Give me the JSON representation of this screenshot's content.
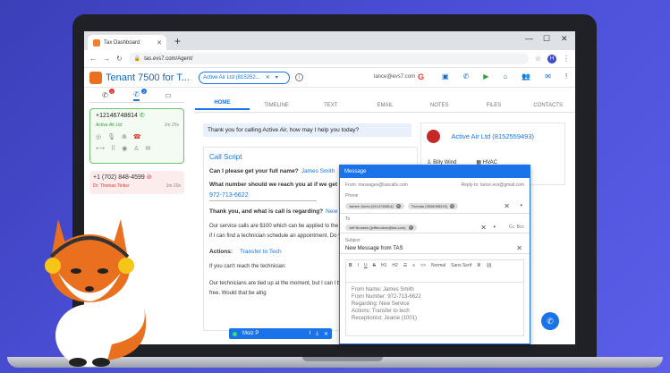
{
  "browser": {
    "tab_title": "Tax Dashboard",
    "url": "tas.evs7.com/Agent/",
    "profile_initial": "H"
  },
  "header": {
    "title": "Tenant 7500 for T...",
    "client_select": "Active Air Ltd (815252...",
    "user_email": "lance@evs7.com"
  },
  "left_panel": {
    "tab_badges": [
      "1",
      "2"
    ],
    "active_call": {
      "number": "+12146748814",
      "name": "Active Air Ltd",
      "duration": "1m 25s"
    },
    "other_call": {
      "number": "+1 (702) 848-4599",
      "name": "Dr. Thomas Tinker",
      "duration": "1m 20s"
    }
  },
  "main": {
    "tabs": [
      "HOME",
      "TIMELINE",
      "TEXT",
      "EMAIL",
      "NOTES",
      "FILES",
      "CONTACTS"
    ],
    "greeting": "Thank you for calling Active Air, how may I help you today?",
    "script": {
      "title": "Call Script",
      "q1": "Can I please get your full name?",
      "a1": "James Smith",
      "q2": "What number should we reach you at if we get",
      "a2": "972-713-6622",
      "q3": "Thank you, and what is call is regarding?",
      "a3": "New",
      "paragraph1": "Our service calls are $100 which can be applied to the for your business. Let me see if I can find a technician schedule an appointment. Do you mind holding?",
      "actions_label": "Actions:",
      "actions_value": "Transfer to Tech",
      "line2": "If you can't reach the technician:",
      "paragraph2": "Our technicians are tied up at the moment, but I can l back just as soon as one gets free. Would that be alrig"
    }
  },
  "client_card": {
    "name": "Active Air Ltd (8152559493)",
    "contact": "Billy Wind",
    "category": "HVAC"
  },
  "message_modal": {
    "title": "Message",
    "from": "From: messages@tascalls.com",
    "reply_to": "Reply-to: lance.evs@gmail.com",
    "phone_label": "Phone",
    "phone_chips": [
      "James Jones (2414748814)",
      "Thomas (3538288415)"
    ],
    "to_label": "To",
    "to_chips": [
      "Jeff Brookes (jeffbrookes@tas.com)"
    ],
    "cc": "Cc",
    "bcc": "Bcc",
    "subject_label": "Subject",
    "subject": "New Message from TAS",
    "toolbar": [
      "B",
      "I",
      "U",
      "S",
      "H1",
      "H2",
      "Normal",
      "Sans Serif"
    ],
    "body_lines": [
      "From Name: James Smith",
      "From Number: 972-713-6622",
      "Regarding: New Service",
      "Actions: Transfer to tech",
      "Receptionist: Jeanie (1001)"
    ]
  },
  "agent_pill": {
    "name": "Moiz P"
  },
  "colors": {
    "background": "#4a4fd6",
    "accent": "#1a73e8",
    "active_call_border": "#6cc46c",
    "missed_call": "#e53935"
  }
}
